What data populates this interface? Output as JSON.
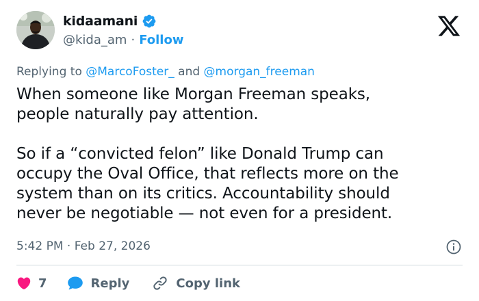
{
  "tweet": {
    "author": {
      "display_name": "kidaamani",
      "handle": "@kida_am",
      "separator": "·",
      "follow_label": "Follow",
      "verified": true,
      "avatar_icon": "profile-photo"
    },
    "platform_logo": "x-logo-icon",
    "replying_prefix": "Replying to",
    "replying_to": [
      "@MarcoFoster_",
      "@morgan_freeman"
    ],
    "replying_joiner": "and",
    "text_paragraphs": [
      [
        "When someone like Morgan Freeman speaks,",
        "people naturally pay attention."
      ],
      [
        "So if a “convicted felon” like Donald Trump can",
        "occupy the Oval Office, that reflects more on the",
        "system than on its critics. Accountability should",
        "never be negotiable — not even for a president."
      ]
    ],
    "timestamp": "5:42 PM · Feb 27, 2026",
    "info_icon": "info-icon",
    "actions": {
      "like_count": "7",
      "reply_label": "Reply",
      "copy_link_label": "Copy link"
    }
  },
  "colors": {
    "text": "#0f1419",
    "secondary": "#536471",
    "accent": "#1d9bf0",
    "like": "#f91880",
    "divider": "#cfd9de"
  }
}
